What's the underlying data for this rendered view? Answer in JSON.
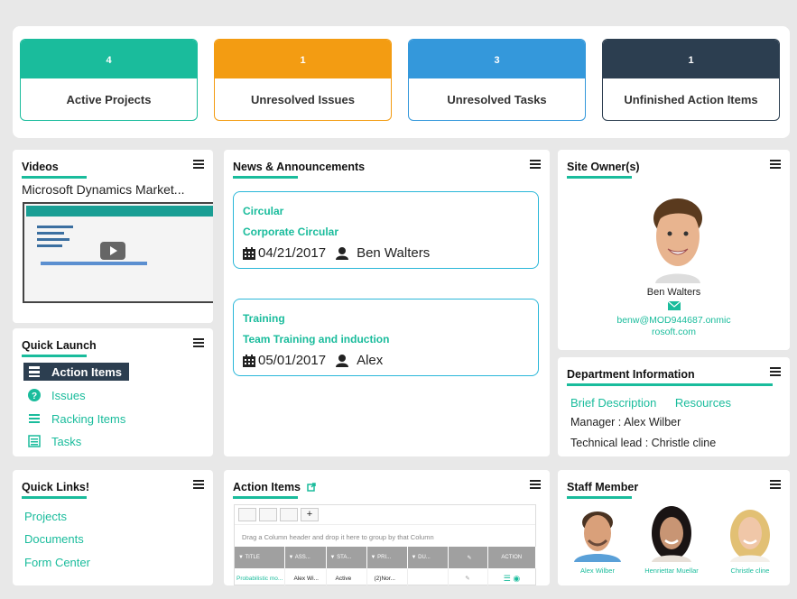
{
  "stats": [
    {
      "count": "4",
      "label": "Active Projects",
      "color": "#1abc9c"
    },
    {
      "count": "1",
      "label": "Unresolved  Issues",
      "color": "#f39c12"
    },
    {
      "count": "3",
      "label": "Unresolved  Tasks",
      "color": "#3498db"
    },
    {
      "count": "1",
      "label": "Unfinished Action Items",
      "color": "#2c3e50"
    }
  ],
  "videos": {
    "title": "Videos",
    "video_title": "Microsoft Dynamics Market..."
  },
  "quick_launch": {
    "title": "Quick Launch",
    "items": [
      {
        "label": "Action Items",
        "icon": "list-icon"
      },
      {
        "label": "Issues",
        "icon": "question-icon"
      },
      {
        "label": "Racking Items",
        "icon": "list-lines-icon"
      },
      {
        "label": "Tasks",
        "icon": "checklist-icon"
      }
    ]
  },
  "news": {
    "title": "News & Announcements",
    "items": [
      {
        "category": "Circular",
        "headline": "Corporate Circular",
        "date": "04/21/2017",
        "author": "Ben Walters"
      },
      {
        "category": "Training",
        "headline": "Team Training and induction",
        "date": "05/01/2017",
        "author": "Alex"
      }
    ]
  },
  "site_owner": {
    "title": "Site Owner(s)",
    "name": "Ben Walters",
    "email_line1": "benw@MOD944687.onmic",
    "email_line2": "rosoft.com"
  },
  "department": {
    "title": "Department Information",
    "link1": "Brief Description",
    "link2": "Resources",
    "manager": "Manager : Alex Wilber",
    "lead": "Technical lead : Christle cline"
  },
  "quick_links": {
    "title": "Quick Links!",
    "items": [
      "Projects",
      "Documents",
      "Form Center"
    ]
  },
  "action_items": {
    "title": "Action Items",
    "drag_hint": "Drag a Column header and drop it here to group by that Column",
    "columns": [
      "TITLE",
      "ASS...",
      "STA...",
      "PRI...",
      "DU..."
    ],
    "action_col": "ACTION",
    "row": [
      "Probabilistic mo...",
      "Alex Wi...",
      "Active",
      "(2)Nor...",
      ""
    ]
  },
  "staff": {
    "title": "Staff Member",
    "members": [
      "Alex Wilber",
      "Henriettar Muellar",
      "Christle cline"
    ]
  }
}
